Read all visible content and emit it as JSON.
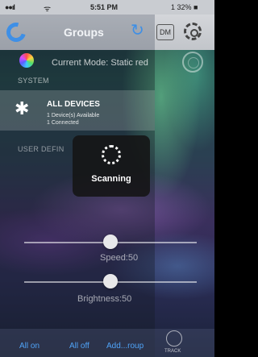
{
  "status_bar": {
    "signal": "●●ıl",
    "wifi": "ᯤ",
    "time": "5:51 PM",
    "battery": "1 32% ■"
  },
  "nav": {
    "title": "Groups",
    "refresh_glyph": "↻",
    "dm_label": "DM"
  },
  "current_mode": {
    "text": "Current Mode: Static red"
  },
  "sections": {
    "system": "SYSTEM",
    "user_defined": "USER DEFIN"
  },
  "all_devices": {
    "title": "ALL DEVICES",
    "available": "1 Device(s) Available",
    "connected": "1 Connected",
    "icon_glyph": "✱"
  },
  "scanning": {
    "label": "Scanning"
  },
  "sliders": {
    "speed": {
      "label": "Speed:50",
      "value": 50
    },
    "brightness": {
      "label": "Brightness:50",
      "value": 50
    }
  },
  "bottom_bar": {
    "all_on": "All on",
    "all_off": "All off",
    "add_group": "Add...roup",
    "track": "TRACK"
  },
  "colors": {
    "accent": "#3e8fe6",
    "link": "#4fa3f7"
  }
}
